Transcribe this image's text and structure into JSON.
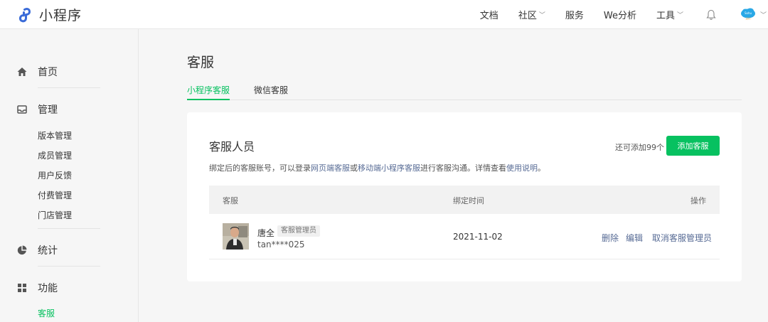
{
  "header": {
    "app_name": "小程序",
    "nav": [
      "文档",
      "社区",
      "服务",
      "We分析",
      "工具"
    ],
    "dropdown_marker": "﹀",
    "avatar_tag": "Sohu",
    "avatar_subtitle": "·天行·"
  },
  "sidebar": {
    "home": "首页",
    "manage": "管理",
    "manage_items": [
      "版本管理",
      "成员管理",
      "用户反馈",
      "付费管理",
      "门店管理"
    ],
    "stats": "统计",
    "features": "功能",
    "features_items": [
      "客服"
    ]
  },
  "main": {
    "title": "客服",
    "tabs": [
      "小程序客服",
      "微信客服"
    ],
    "card": {
      "title": "客服人员",
      "desc_prefix": "绑定后的客服账号，可以登录",
      "desc_link1": "网页端客服",
      "desc_mid": "或",
      "desc_link2": "移动端小程序客服",
      "desc_suffix": "进行客服沟通。详情查看",
      "desc_link3": "使用说明",
      "desc_end": "。",
      "remaining": "还可添加99个",
      "add_button": "添加客服",
      "columns": [
        "客服",
        "绑定时间",
        "操作"
      ],
      "rows": [
        {
          "name": "唐全",
          "role_tag": "客服管理员",
          "account": "tan****025",
          "bind_date": "2021-11-02",
          "actions": [
            "删除",
            "编辑",
            "取消客服管理员"
          ]
        }
      ]
    }
  },
  "colors": {
    "accent": "#07c160",
    "link": "#576b95",
    "background": "#f6f6f6"
  },
  "icons": [
    "logo-icon",
    "bell-icon",
    "user-avatar",
    "home-icon",
    "manage-icon",
    "stats-icon",
    "features-icon"
  ]
}
